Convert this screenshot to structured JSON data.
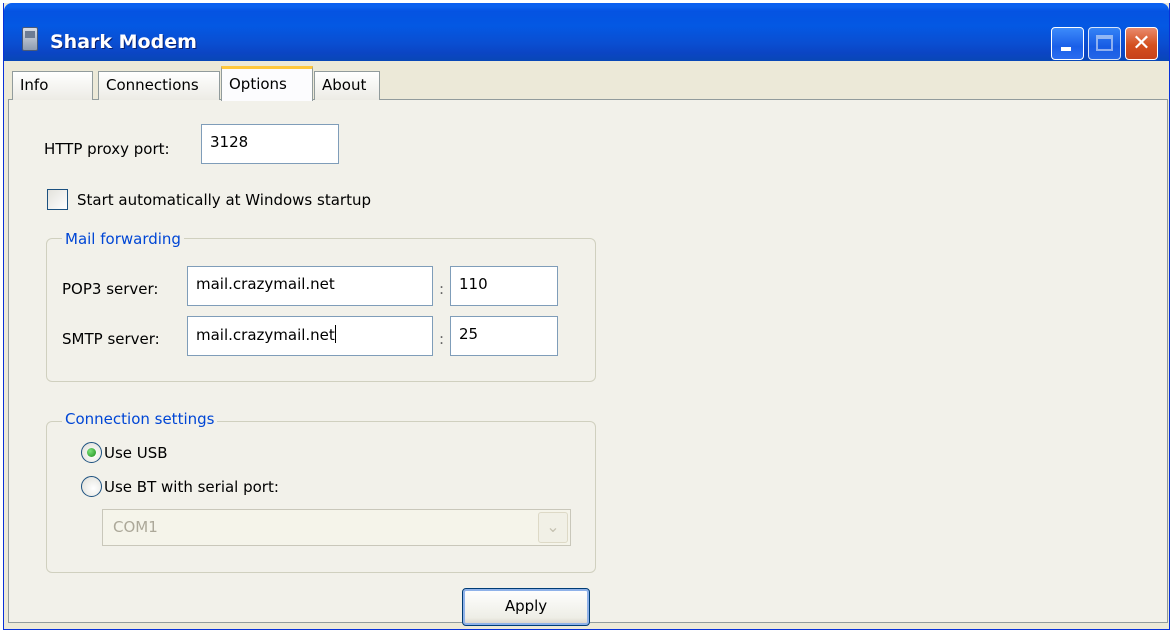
{
  "window": {
    "title": "Shark Modem"
  },
  "tabs": [
    {
      "label": "Info"
    },
    {
      "label": "Connections"
    },
    {
      "label": "Options"
    },
    {
      "label": "About"
    }
  ],
  "active_tab": "Options",
  "options": {
    "http_proxy_label": "HTTP proxy port:",
    "http_proxy_value": "3128",
    "autostart_label": "Start automatically at Windows startup",
    "autostart_checked": false,
    "mail": {
      "legend": "Mail forwarding",
      "pop3_label": "POP3 server:",
      "pop3_host": "mail.crazymail.net",
      "pop3_port": "110",
      "smtp_label": "SMTP server:",
      "smtp_host": "mail.crazymail.net",
      "smtp_port": "25",
      "separator": ":"
    },
    "connection": {
      "legend": "Connection settings",
      "usb_label": "Use USB",
      "usb_selected": true,
      "bt_label": "Use BT with serial port:",
      "bt_selected": false,
      "serial_port_value": "COM1"
    },
    "apply_label": "Apply"
  }
}
